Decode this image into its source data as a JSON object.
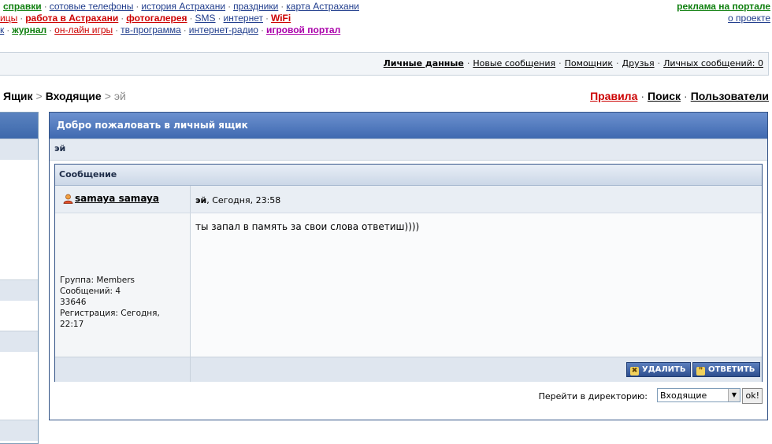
{
  "top_links": {
    "row1": [
      {
        "label": "справки",
        "style": "green"
      },
      {
        "label": "сотовые телефоны",
        "style": "blue"
      },
      {
        "label": "история Астрахани",
        "style": "blue"
      },
      {
        "label": "праздники",
        "style": "blue"
      },
      {
        "label": "карта Астрахани",
        "style": "blue"
      }
    ],
    "row2": [
      {
        "label": "ицы",
        "style": "plainred"
      },
      {
        "label": "работа в Астрахани",
        "style": "red"
      },
      {
        "label": "фотогалерея",
        "style": "red"
      },
      {
        "label": "SMS",
        "style": "blue"
      },
      {
        "label": "интернет",
        "style": "blue"
      },
      {
        "label": "WiFi",
        "style": "red"
      }
    ],
    "row3": [
      {
        "label": "к",
        "style": "blue"
      },
      {
        "label": "журнал",
        "style": "green"
      },
      {
        "label": "он-лайн игры",
        "style": "plainred"
      },
      {
        "label": "тв-программа",
        "style": "blue"
      },
      {
        "label": "интернет-радио",
        "style": "blue"
      },
      {
        "label": "игровой портал",
        "style": "purple"
      }
    ],
    "ads_label": "реклама на портале",
    "about_label": "о проекте"
  },
  "userbar": {
    "personal": "Личные данные",
    "new_messages": "Новые сообщения",
    "assistant": "Помощник",
    "friends": "Друзья",
    "pm_count": "Личных сообщений: 0"
  },
  "navstrip": {
    "inbox_root": "Ящик",
    "sep1": ">",
    "folder": "Входящие",
    "sep2": ">",
    "current": "эй"
  },
  "nav_right": {
    "rules": "Правила",
    "search": "Поиск",
    "users": "Пользователи"
  },
  "panel": {
    "title": "Добро пожаловать в личный ящик",
    "subject": "эй"
  },
  "message": {
    "header": "Сообщение",
    "author": "samaya samaya",
    "subject": "эй",
    "date": ", Сегодня, 23:58",
    "text": "ты запал в память за свои слова ответиш))))",
    "profile": {
      "group": "Группа: Members",
      "posts": "Сообщений: 4",
      "id": "33646",
      "reg1": "Регистрация: Сегодня,",
      "reg2": "22:17"
    },
    "delete_label": "УДАЛИТЬ",
    "reply_label": "ОТВЕТИТЬ"
  },
  "jump": {
    "label": "Перейти в директорию:",
    "selected": "Входящие",
    "ok": "ok!"
  },
  "colors": {
    "accent": "#3f69b0",
    "rules_link": "#cc0000"
  }
}
